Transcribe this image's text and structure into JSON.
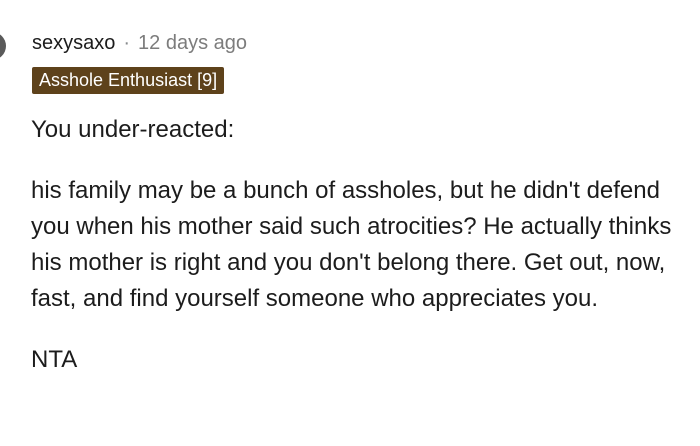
{
  "comment": {
    "username": "sexysaxo",
    "separator": "·",
    "timestamp": "12 days ago",
    "flair": "Asshole Enthusiast [9]",
    "paragraphs": [
      "You under-reacted:",
      "his family may be a bunch of assholes, but he didn't defend you when his mother said such atrocities? He actually thinks his mother is right and you don't belong there. Get out, now, fast, and find yourself someone who appreciates you.",
      "NTA"
    ]
  },
  "colors": {
    "flair_background": "#5e421b",
    "flair_text": "#ffffff",
    "timestamp": "#7c7c7c",
    "body_text": "#1c1c1c"
  }
}
